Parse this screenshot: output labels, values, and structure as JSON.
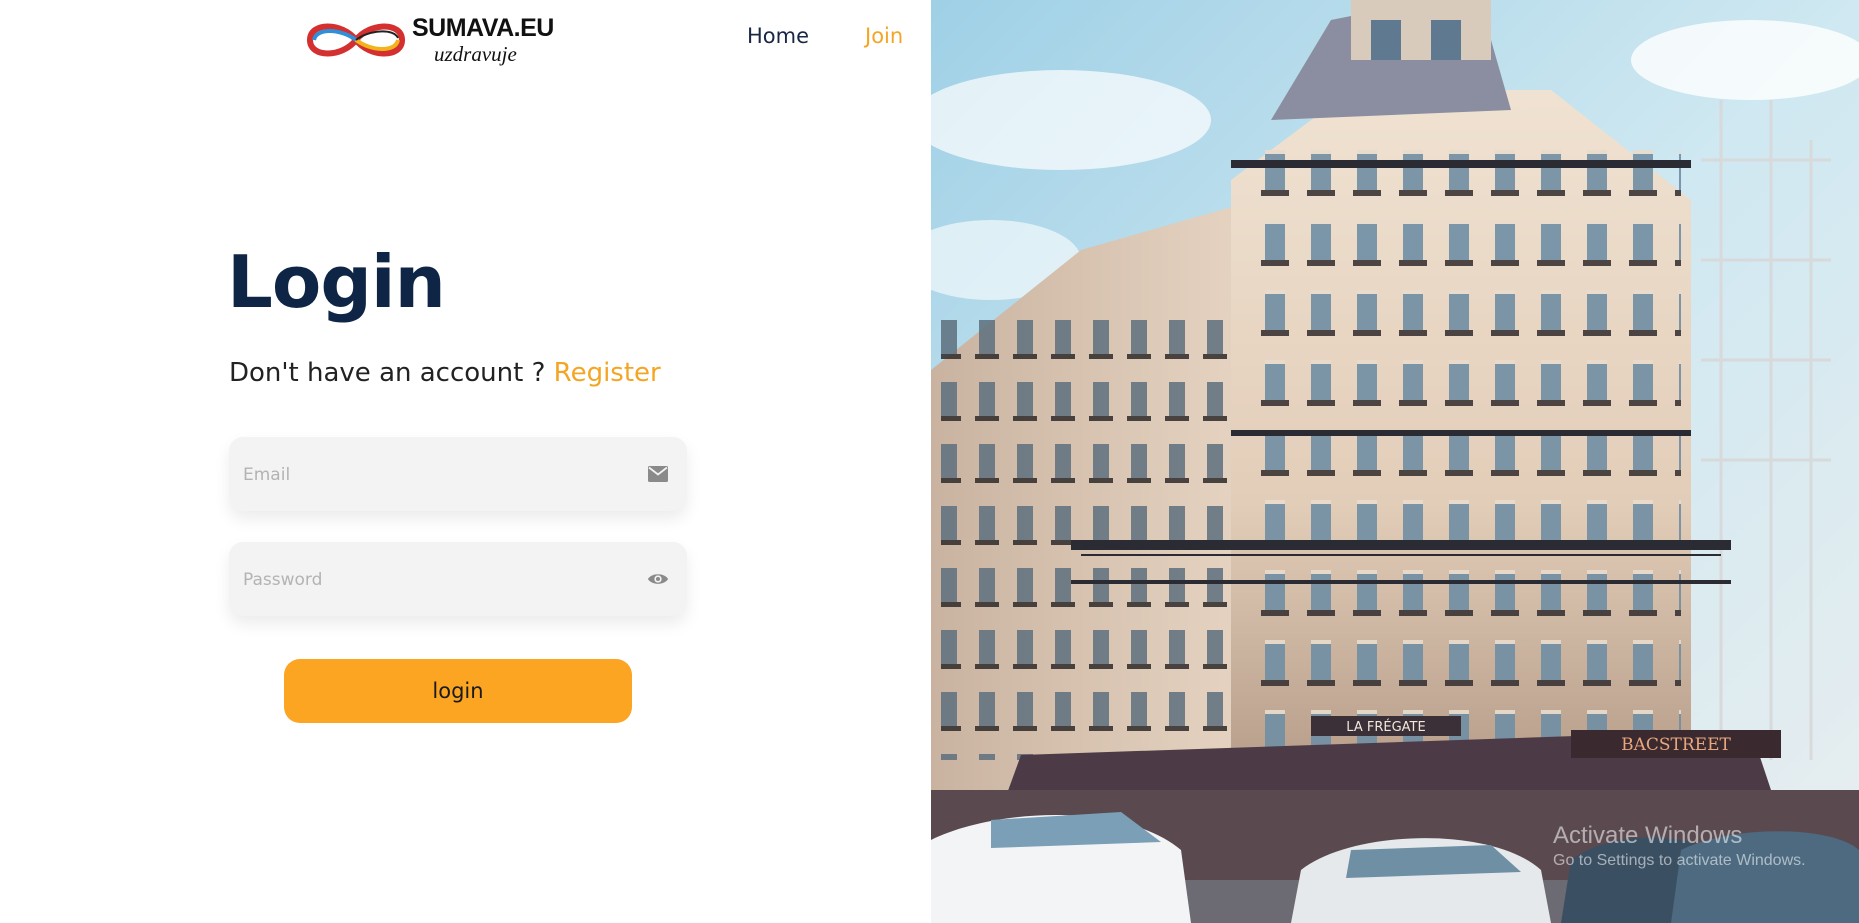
{
  "brand": {
    "name": "SUMAVA.EU",
    "tagline": "uzdravuje"
  },
  "nav": {
    "home": "Home",
    "join": "Join"
  },
  "login": {
    "title": "Login",
    "prompt": "Don't have an account ?",
    "register_link": "Register",
    "email_placeholder": "Email",
    "password_placeholder": "Password",
    "submit_label": "login"
  },
  "hero_image": {
    "storefront_sign": "LA FRÉGATE",
    "shop_sign": "BACSTREET"
  },
  "watermark": {
    "line1": "Activate Windows",
    "line2": "Go to Settings to activate Windows."
  },
  "colors": {
    "accent": "#f5a524",
    "button": "#fca522",
    "heading": "#0f2545",
    "field_bg": "#f3f3f3"
  },
  "icons": {
    "email": "envelope-icon",
    "password": "eye-icon"
  }
}
